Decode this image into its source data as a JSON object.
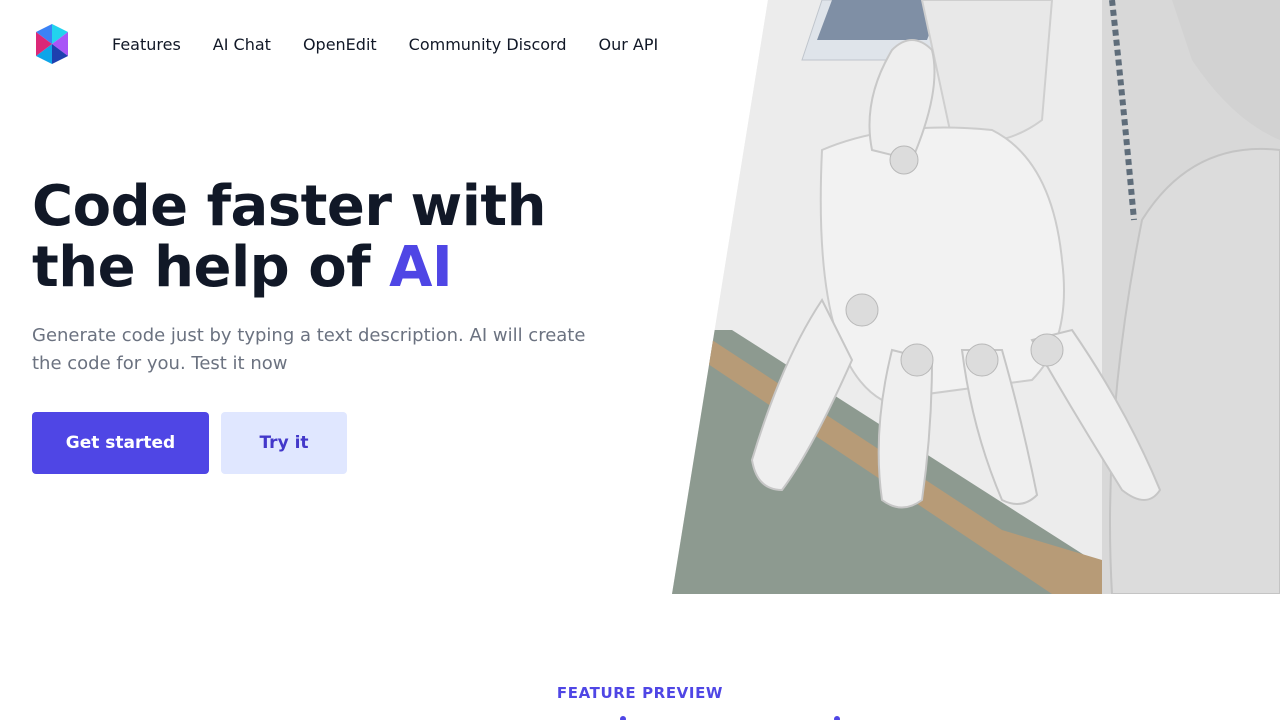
{
  "nav": {
    "logo_icon": "hexagon-triangles-logo-icon",
    "links": [
      "Features",
      "AI Chat",
      "OpenEdit",
      "Community Discord",
      "Our API"
    ]
  },
  "hero": {
    "title_main": "Code faster with the help of ",
    "title_accent": "AI",
    "subtitle": "Generate code just by typing a text description. AI will create the code for you. Test it now",
    "primary_button": "Get started",
    "secondary_button": "Try it"
  },
  "image": {
    "icon": "robot-hand-photo"
  },
  "feature_section": {
    "eyebrow": "FEATURE PREVIEW"
  },
  "colors": {
    "accent": "#4f46e5",
    "accent_light": "#e0e7ff",
    "heading": "#111827",
    "body": "#6b7280"
  }
}
